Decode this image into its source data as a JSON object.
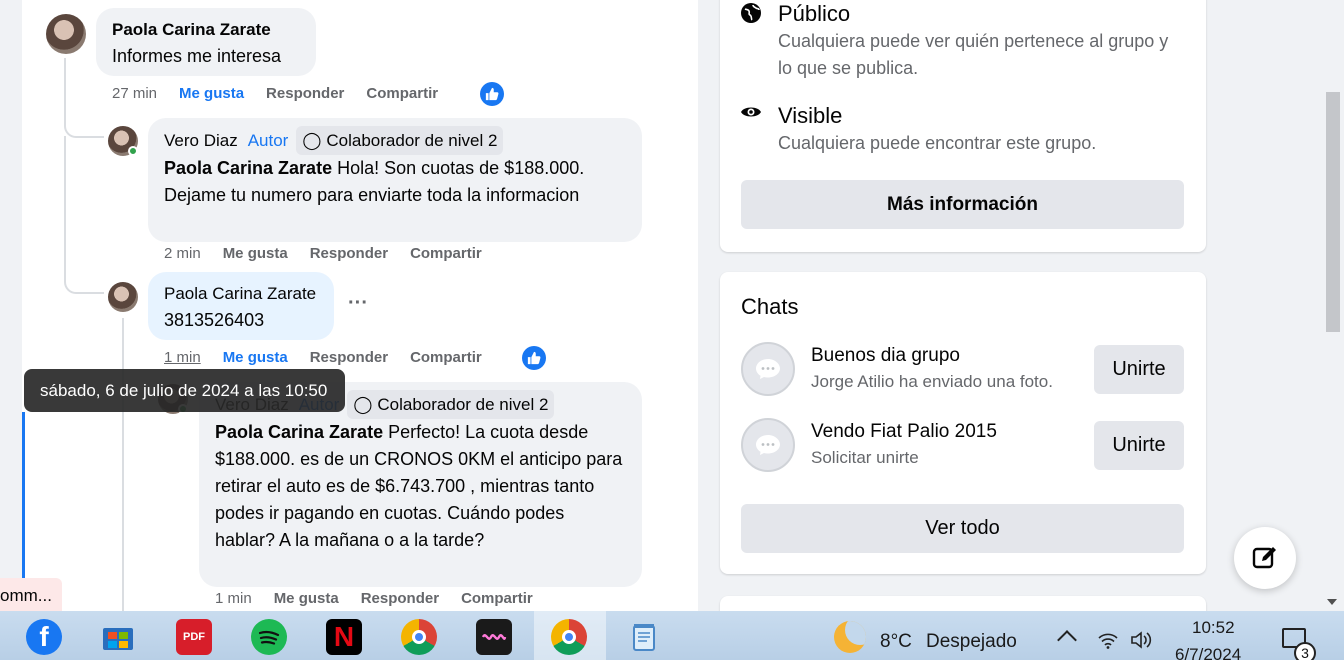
{
  "feed": {
    "comment1": {
      "author": "Paola Carina Zarate",
      "text": "Informes me interesa",
      "time": "27 min",
      "like": "Me gusta",
      "reply": "Responder",
      "share": "Compartir"
    },
    "reply1": {
      "author": "Vero Diaz",
      "author_tag": "Autor",
      "level_tag": "Colaborador de nivel 2",
      "mention": "Paola Carina Zarate",
      "text": " Hola! Son cuotas de $188.000. Dejame tu numero para enviarte toda la informacion",
      "time": "2 min",
      "like": "Me gusta",
      "reply": "Responder",
      "share": "Compartir"
    },
    "reply2": {
      "author": "Paola Carina Zarate",
      "text": "3813526403",
      "more": "···",
      "time": "1 min",
      "like": "Me gusta",
      "reply": "Responder",
      "share": "Compartir"
    },
    "reply3": {
      "author": "Vero Diaz",
      "author_tag": "Autor",
      "level_tag": "Colaborador de nivel 2",
      "mention": "Paola Carina Zarate",
      "text": " Perfecto! La cuota desde $188.000. es de un CRONOS 0KM el anticipo para retirar el auto es de $6.743.700 , mientras tanto podes ir pagando en cuotas. Cuándo podes hablar? A la mañana o a la tarde?",
      "time": "1 min",
      "like": "Me gusta",
      "reply": "Responder",
      "share": "Compartir"
    },
    "tooltip": "sábado, 6 de julio de 2024 a las 10:50",
    "comment_preview": "omm..."
  },
  "sidebar": {
    "public_title": "Público",
    "public_desc": "Cualquiera puede ver quién pertenece al grupo y lo que se publica.",
    "visible_title": "Visible",
    "visible_desc": "Cualquiera puede encontrar este grupo.",
    "more_info": "Más información",
    "chats_title": "Chats",
    "chats": [
      {
        "title": "Buenos dia grupo",
        "subtitle": "Jorge Atilio ha enviado una foto.",
        "button": "Unirte"
      },
      {
        "title": "Vendo Fiat Palio 2015",
        "subtitle": "Solicitar unirte",
        "button": "Unirte"
      }
    ],
    "see_all": "Ver todo"
  },
  "taskbar": {
    "pdf_label": "PDF",
    "weather_temp": "8°C",
    "weather_desc": "Despejado",
    "time": "10:52",
    "date": "6/7/2024",
    "notifications": "3"
  },
  "colors": {
    "accent": "#1877f2",
    "bubble": "#f0f2f5",
    "bubble_highlight": "#e7f3ff",
    "online": "#31a24c"
  }
}
